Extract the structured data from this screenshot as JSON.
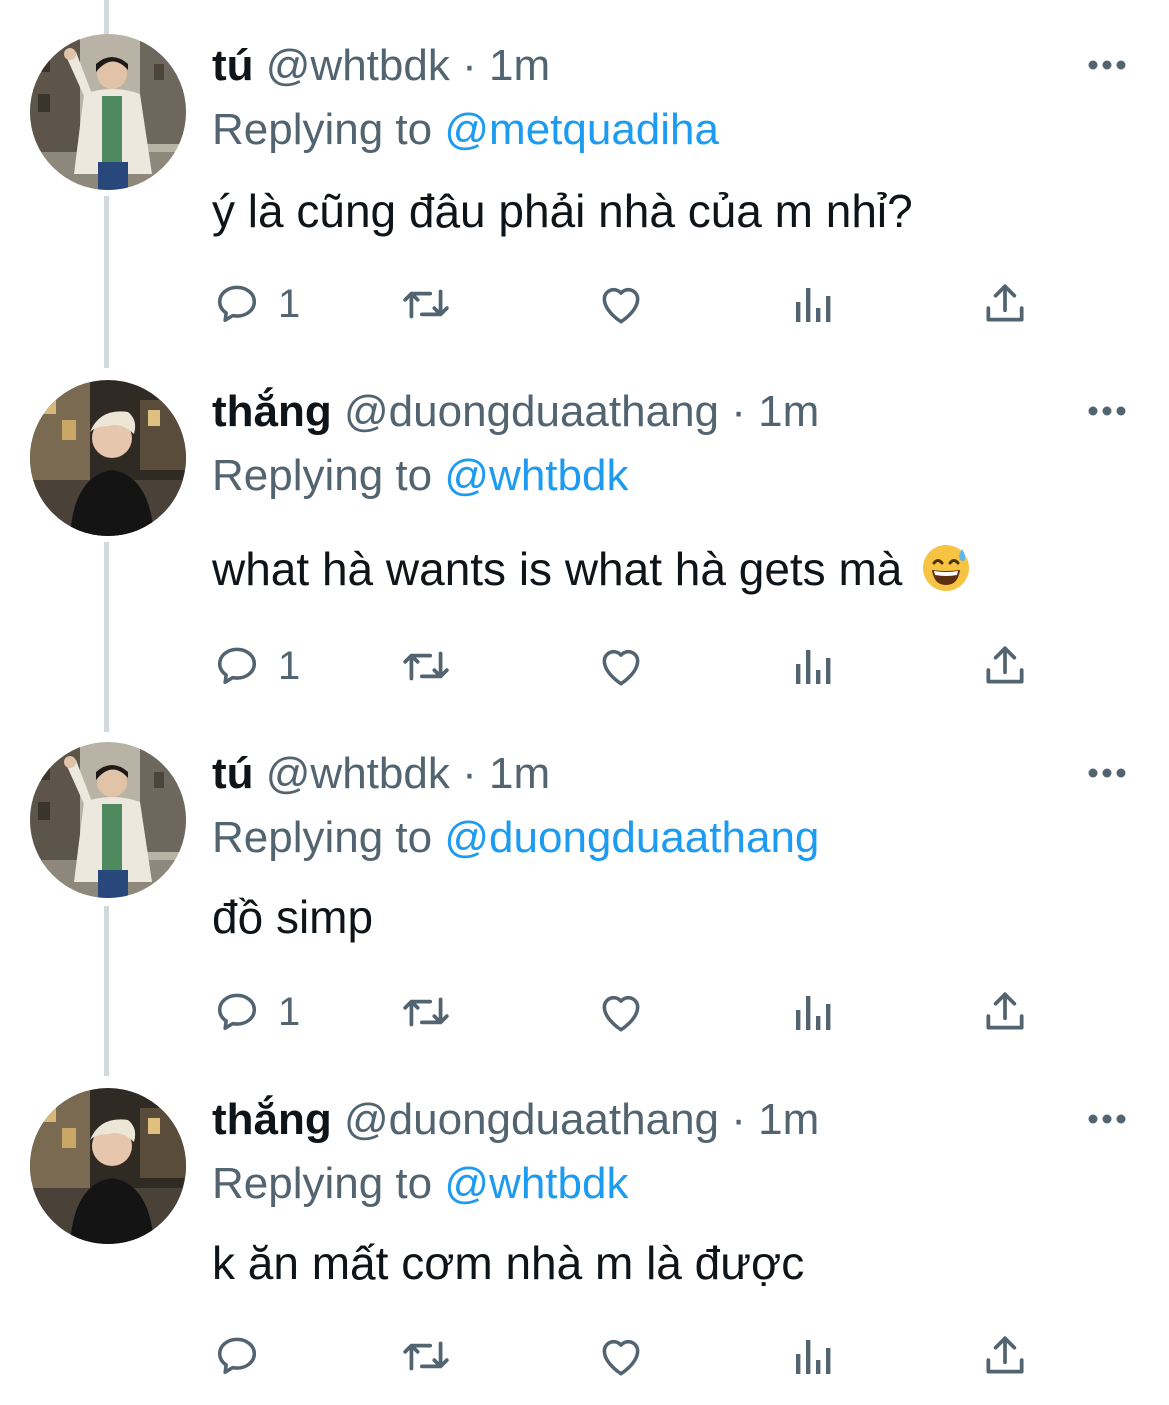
{
  "icons": {
    "reply": "reply-icon",
    "retweet": "retweet-icon",
    "like": "heart-icon",
    "views": "views-icon",
    "share": "share-icon",
    "more": "more-icon"
  },
  "colors": {
    "link": "#1d9bf0",
    "secondary_text": "#536471",
    "primary_text": "#0f1419",
    "thread_line": "#cfd9de"
  },
  "replying_label": "Replying to",
  "tweets": [
    {
      "name": "tú",
      "handle": "@whtbdk",
      "separator": "·",
      "time": "1m",
      "reply_to": "@metquadiha",
      "text": "ý là cũng đâu phải nhà của m nhỉ?",
      "reply_count": "1"
    },
    {
      "name": "thắng",
      "handle": "@duongduaathang",
      "separator": "·",
      "time": "1m",
      "reply_to": "@whtbdk",
      "text": "what hà wants is what hà gets mà",
      "emoji": "grinning-face-with-sweat",
      "reply_count": "1"
    },
    {
      "name": "tú",
      "handle": "@whtbdk",
      "separator": "·",
      "time": "1m",
      "reply_to": "@duongduaathang",
      "text": "đồ simp",
      "reply_count": "1"
    },
    {
      "name": "thắng",
      "handle": "@duongduaathang",
      "separator": "·",
      "time": "1m",
      "reply_to": "@whtbdk",
      "text": "k ăn mất cơm nhà m là được",
      "reply_count": ""
    }
  ]
}
